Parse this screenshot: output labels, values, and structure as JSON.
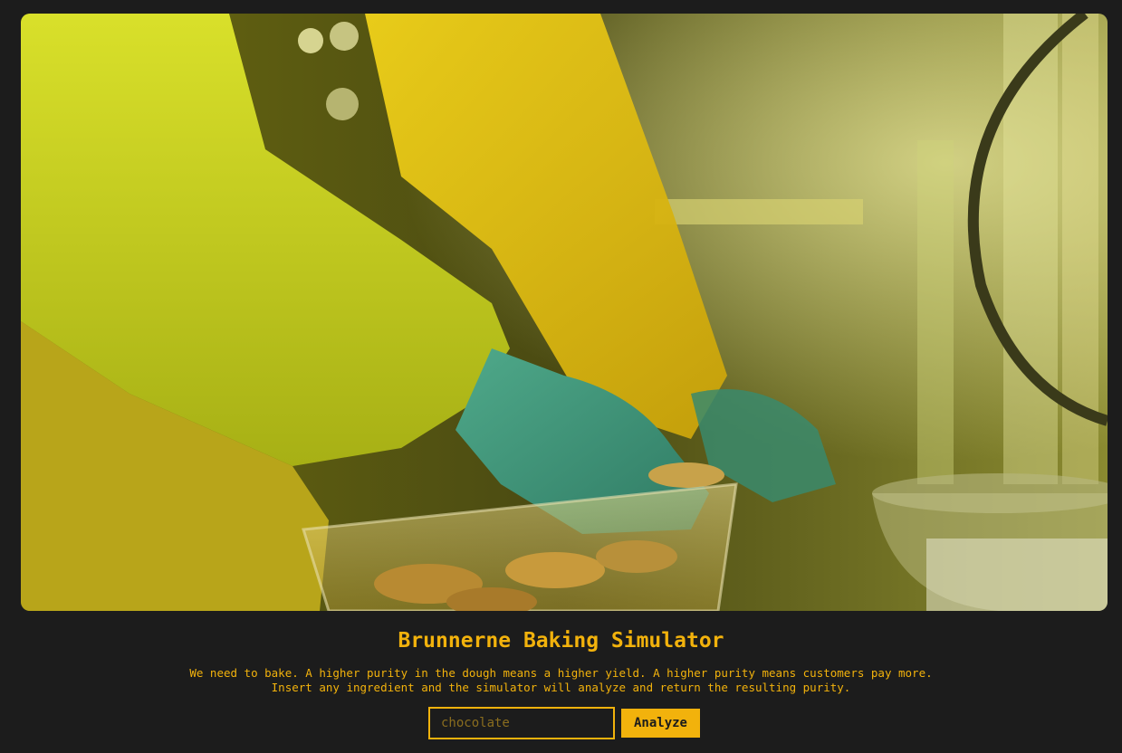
{
  "hero": {
    "alt": "Gloved hand reaching into a container of cookies in a lab"
  },
  "header": {
    "title": "Brunnerne Baking Simulator"
  },
  "intro": {
    "line1": "We need to bake. A higher purity in the dough means a higher yield. A higher purity means customers pay more.",
    "line2": "Insert any ingredient and the simulator will analyze and return the resulting purity."
  },
  "form": {
    "ingredient_placeholder": "chocolate",
    "ingredient_value": "",
    "analyze_label": "Analyze"
  },
  "colors": {
    "background": "#1c1c1c",
    "accent": "#f2b20c"
  }
}
